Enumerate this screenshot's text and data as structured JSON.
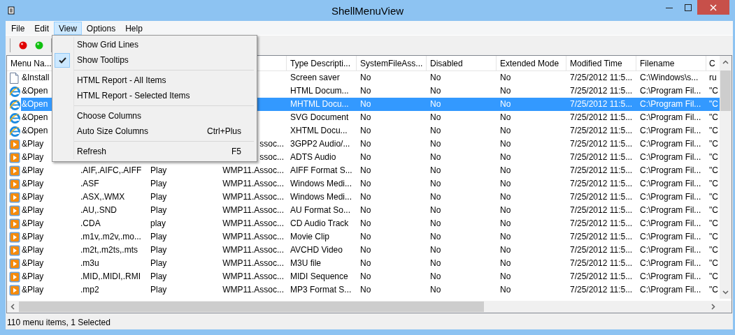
{
  "window": {
    "title": "ShellMenuView"
  },
  "menu_bar": [
    {
      "label": "File",
      "selected": false
    },
    {
      "label": "Edit",
      "selected": false
    },
    {
      "label": "View",
      "selected": true
    },
    {
      "label": "Options",
      "selected": false
    },
    {
      "label": "Help",
      "selected": false
    }
  ],
  "toolbar": [
    {
      "kind": "separator"
    },
    {
      "kind": "ball",
      "color": "#e00000"
    },
    {
      "kind": "ball",
      "color": "#10c010"
    },
    {
      "kind": "separator"
    }
  ],
  "view_menu": [
    {
      "kind": "item",
      "label": "Show Grid Lines",
      "checked": false
    },
    {
      "kind": "item",
      "label": "Show Tooltips",
      "checked": true
    },
    {
      "kind": "separator"
    },
    {
      "kind": "item",
      "label": "HTML Report - All Items",
      "checked": false
    },
    {
      "kind": "item",
      "label": "HTML Report - Selected Items",
      "checked": false
    },
    {
      "kind": "separator"
    },
    {
      "kind": "item",
      "label": "Choose Columns",
      "checked": false
    },
    {
      "kind": "item",
      "label": "Auto Size Columns",
      "shortcut": "Ctrl+Plus",
      "checked": false
    },
    {
      "kind": "separator"
    },
    {
      "kind": "item",
      "label": "Refresh",
      "shortcut": "F5",
      "checked": false
    }
  ],
  "table": {
    "columns": [
      {
        "label": "Menu Na..."
      },
      {},
      {},
      {},
      {
        "label": "Type Descripti..."
      },
      {
        "label": "SystemFileAss..."
      },
      {
        "label": "Disabled"
      },
      {
        "label": "Extended Mode"
      },
      {
        "label": "Modified Time"
      },
      {
        "label": "Filename"
      },
      {
        "label": "C"
      }
    ],
    "rows": [
      {
        "kind": "document",
        "selected": false,
        "cells": [
          "&Install",
          null,
          null,
          null,
          "Screen saver",
          "No",
          "No",
          "No",
          "7/25/2012 11:5...",
          "C:\\Windows\\s...",
          "ru"
        ]
      },
      {
        "kind": "browser",
        "selected": false,
        "cells": [
          "&Open",
          null,
          null,
          null,
          "HTML Docum...",
          "No",
          "No",
          "No",
          "7/25/2012 11:5...",
          "C:\\Program Fil...",
          "\"C"
        ]
      },
      {
        "kind": "browser",
        "selected": true,
        "cells": [
          "&Open",
          null,
          null,
          null,
          "MHTML Docu...",
          "No",
          "No",
          "No",
          "7/25/2012 11:5...",
          "C:\\Program Fil...",
          "\"C"
        ]
      },
      {
        "kind": "browser",
        "selected": false,
        "cells": [
          "&Open",
          null,
          null,
          null,
          "SVG Document",
          "No",
          "No",
          "No",
          "7/25/2012 11:5...",
          "C:\\Program Fil...",
          "\"C"
        ]
      },
      {
        "kind": "browser",
        "selected": false,
        "cells": [
          "&Open",
          null,
          null,
          null,
          "XHTML Docu...",
          "No",
          "No",
          "No",
          "7/25/2012 11:5...",
          "C:\\Program Fil...",
          "\"C"
        ]
      },
      {
        "kind": "player",
        "selected": false,
        "cells": [
          "&Play",
          null,
          null,
          "ssoc...",
          "3GPP2 Audio/...",
          "No",
          "No",
          "No",
          "7/25/2012 11:5...",
          "C:\\Program Fil...",
          "\"C"
        ]
      },
      {
        "kind": "player",
        "selected": false,
        "cells": [
          "&Play",
          null,
          null,
          "ssoc...",
          "ADTS Audio",
          "No",
          "No",
          "No",
          "7/25/2012 11:5...",
          "C:\\Program Fil...",
          "\"C"
        ]
      },
      {
        "kind": "player",
        "selected": false,
        "cells": [
          "&Play",
          ".AIF,.AIFC,.AIFF",
          "Play",
          "WMP11.Assoc...",
          "AIFF Format S...",
          "No",
          "No",
          "No",
          "7/25/2012 11:5...",
          "C:\\Program Fil...",
          "\"C"
        ]
      },
      {
        "kind": "player",
        "selected": false,
        "cells": [
          "&Play",
          ".ASF",
          "Play",
          "WMP11.Assoc...",
          "Windows Medi...",
          "No",
          "No",
          "No",
          "7/25/2012 11:5...",
          "C:\\Program Fil...",
          "\"C"
        ]
      },
      {
        "kind": "player",
        "selected": false,
        "cells": [
          "&Play",
          ".ASX,.WMX",
          "Play",
          "WMP11.Assoc...",
          "Windows Medi...",
          "No",
          "No",
          "No",
          "7/25/2012 11:5...",
          "C:\\Program Fil...",
          "\"C"
        ]
      },
      {
        "kind": "player",
        "selected": false,
        "cells": [
          "&Play",
          ".AU,.SND",
          "Play",
          "WMP11.Assoc...",
          "AU Format So...",
          "No",
          "No",
          "No",
          "7/25/2012 11:5...",
          "C:\\Program Fil...",
          "\"C"
        ]
      },
      {
        "kind": "player",
        "selected": false,
        "cells": [
          "&Play",
          ".CDA",
          "play",
          "WMP11.Assoc...",
          "CD Audio Track",
          "No",
          "No",
          "No",
          "7/25/2012 11:5...",
          "C:\\Program Fil...",
          "\"C"
        ]
      },
      {
        "kind": "player",
        "selected": false,
        "cells": [
          "&Play",
          ".m1v,.m2v,.mo...",
          "Play",
          "WMP11.Assoc...",
          "Movie Clip",
          "No",
          "No",
          "No",
          "7/25/2012 11:5...",
          "C:\\Program Fil...",
          "\"C"
        ]
      },
      {
        "kind": "player",
        "selected": false,
        "cells": [
          "&Play",
          ".m2t,.m2ts,.mts",
          "Play",
          "WMP11.Assoc...",
          "AVCHD Video",
          "No",
          "No",
          "No",
          "7/25/2012 11:5...",
          "C:\\Program Fil...",
          "\"C"
        ]
      },
      {
        "kind": "player",
        "selected": false,
        "cells": [
          "&Play",
          ".m3u",
          "Play",
          "WMP11.Assoc...",
          "M3U file",
          "No",
          "No",
          "No",
          "7/25/2012 11:5...",
          "C:\\Program Fil...",
          "\"C"
        ]
      },
      {
        "kind": "player",
        "selected": false,
        "cells": [
          "&Play",
          ".MID,.MIDI,.RMI",
          "Play",
          "WMP11.Assoc...",
          "MIDI Sequence",
          "No",
          "No",
          "No",
          "7/25/2012 11:5...",
          "C:\\Program Fil...",
          "\"C"
        ]
      },
      {
        "kind": "player",
        "selected": false,
        "cells": [
          "&Play",
          ".mp2",
          "Play",
          "WMP11.Assoc...",
          "MP3 Format S...",
          "No",
          "No",
          "No",
          "7/25/2012 11:5...",
          "C:\\Program Fil...",
          "\"C"
        ]
      }
    ]
  },
  "status_bar": "110 menu items, 1 Selected"
}
